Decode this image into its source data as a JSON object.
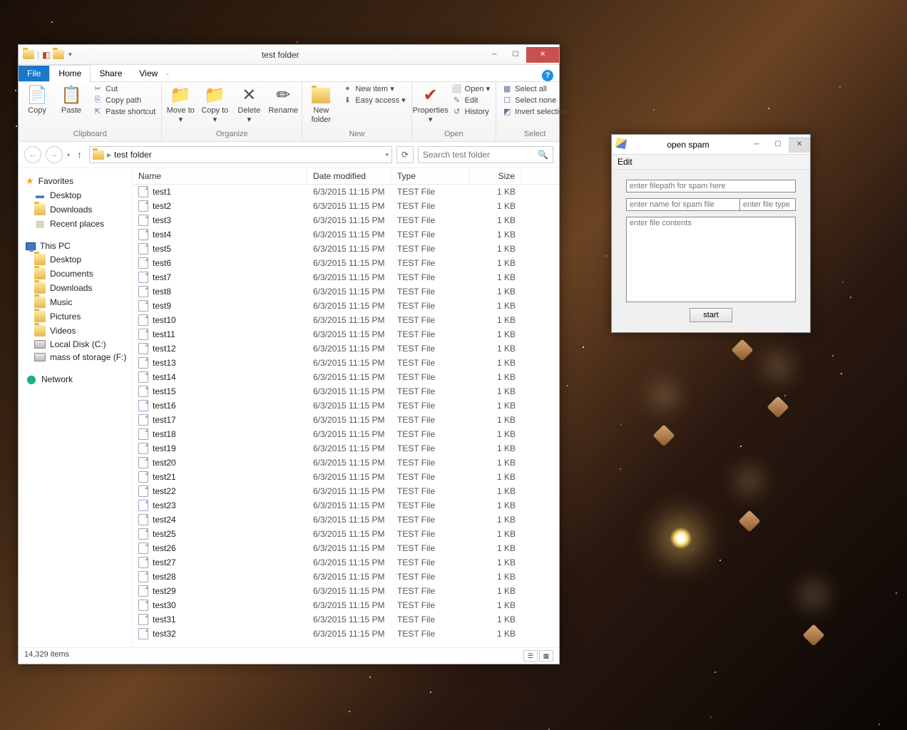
{
  "explorer": {
    "title": "test folder",
    "tabs": {
      "file": "File",
      "home": "Home",
      "share": "Share",
      "view": "View"
    },
    "ribbon": {
      "clipboard": {
        "copy": "Copy",
        "paste": "Paste",
        "cut": "Cut",
        "copy_path": "Copy path",
        "paste_shortcut": "Paste shortcut",
        "label": "Clipboard"
      },
      "organize": {
        "move_to": "Move to ▾",
        "copy_to": "Copy to ▾",
        "delete": "Delete ▾",
        "rename": "Rename",
        "label": "Organize"
      },
      "new": {
        "new_folder": "New folder",
        "new_item": "New item ▾",
        "easy_access": "Easy access ▾",
        "label": "New"
      },
      "open": {
        "properties": "Properties ▾",
        "open": "Open ▾",
        "edit": "Edit",
        "history": "History",
        "label": "Open"
      },
      "select": {
        "select_all": "Select all",
        "select_none": "Select none",
        "invert": "Invert selection",
        "label": "Select"
      }
    },
    "address": {
      "path": "test folder",
      "search_placeholder": "Search test folder"
    },
    "nav": {
      "favorites": "Favorites",
      "desktop": "Desktop",
      "downloads": "Downloads",
      "recent": "Recent places",
      "this_pc": "This PC",
      "documents": "Documents",
      "music": "Music",
      "pictures": "Pictures",
      "videos": "Videos",
      "local_disk": "Local Disk (C:)",
      "mass_storage": "mass of storage (F:)",
      "network": "Network"
    },
    "columns": {
      "name": "Name",
      "date": "Date modified",
      "type": "Type",
      "size": "Size"
    },
    "files": [
      {
        "name": "test1",
        "date": "6/3/2015 11:15 PM",
        "type": "TEST File",
        "size": "1 KB"
      },
      {
        "name": "test2",
        "date": "6/3/2015 11:15 PM",
        "type": "TEST File",
        "size": "1 KB"
      },
      {
        "name": "test3",
        "date": "6/3/2015 11:15 PM",
        "type": "TEST File",
        "size": "1 KB"
      },
      {
        "name": "test4",
        "date": "6/3/2015 11:15 PM",
        "type": "TEST File",
        "size": "1 KB"
      },
      {
        "name": "test5",
        "date": "6/3/2015 11:15 PM",
        "type": "TEST File",
        "size": "1 KB"
      },
      {
        "name": "test6",
        "date": "6/3/2015 11:15 PM",
        "type": "TEST File",
        "size": "1 KB"
      },
      {
        "name": "test7",
        "date": "6/3/2015 11:15 PM",
        "type": "TEST File",
        "size": "1 KB"
      },
      {
        "name": "test8",
        "date": "6/3/2015 11:15 PM",
        "type": "TEST File",
        "size": "1 KB"
      },
      {
        "name": "test9",
        "date": "6/3/2015 11:15 PM",
        "type": "TEST File",
        "size": "1 KB"
      },
      {
        "name": "test10",
        "date": "6/3/2015 11:15 PM",
        "type": "TEST File",
        "size": "1 KB"
      },
      {
        "name": "test11",
        "date": "6/3/2015 11:15 PM",
        "type": "TEST File",
        "size": "1 KB"
      },
      {
        "name": "test12",
        "date": "6/3/2015 11:15 PM",
        "type": "TEST File",
        "size": "1 KB"
      },
      {
        "name": "test13",
        "date": "6/3/2015 11:15 PM",
        "type": "TEST File",
        "size": "1 KB"
      },
      {
        "name": "test14",
        "date": "6/3/2015 11:15 PM",
        "type": "TEST File",
        "size": "1 KB"
      },
      {
        "name": "test15",
        "date": "6/3/2015 11:15 PM",
        "type": "TEST File",
        "size": "1 KB"
      },
      {
        "name": "test16",
        "date": "6/3/2015 11:15 PM",
        "type": "TEST File",
        "size": "1 KB"
      },
      {
        "name": "test17",
        "date": "6/3/2015 11:15 PM",
        "type": "TEST File",
        "size": "1 KB"
      },
      {
        "name": "test18",
        "date": "6/3/2015 11:15 PM",
        "type": "TEST File",
        "size": "1 KB"
      },
      {
        "name": "test19",
        "date": "6/3/2015 11:15 PM",
        "type": "TEST File",
        "size": "1 KB"
      },
      {
        "name": "test20",
        "date": "6/3/2015 11:15 PM",
        "type": "TEST File",
        "size": "1 KB"
      },
      {
        "name": "test21",
        "date": "6/3/2015 11:15 PM",
        "type": "TEST File",
        "size": "1 KB"
      },
      {
        "name": "test22",
        "date": "6/3/2015 11:15 PM",
        "type": "TEST File",
        "size": "1 KB"
      },
      {
        "name": "test23",
        "date": "6/3/2015 11:15 PM",
        "type": "TEST File",
        "size": "1 KB"
      },
      {
        "name": "test24",
        "date": "6/3/2015 11:15 PM",
        "type": "TEST File",
        "size": "1 KB"
      },
      {
        "name": "test25",
        "date": "6/3/2015 11:15 PM",
        "type": "TEST File",
        "size": "1 KB"
      },
      {
        "name": "test26",
        "date": "6/3/2015 11:15 PM",
        "type": "TEST File",
        "size": "1 KB"
      },
      {
        "name": "test27",
        "date": "6/3/2015 11:15 PM",
        "type": "TEST File",
        "size": "1 KB"
      },
      {
        "name": "test28",
        "date": "6/3/2015 11:15 PM",
        "type": "TEST File",
        "size": "1 KB"
      },
      {
        "name": "test29",
        "date": "6/3/2015 11:15 PM",
        "type": "TEST File",
        "size": "1 KB"
      },
      {
        "name": "test30",
        "date": "6/3/2015 11:15 PM",
        "type": "TEST File",
        "size": "1 KB"
      },
      {
        "name": "test31",
        "date": "6/3/2015 11:15 PM",
        "type": "TEST File",
        "size": "1 KB"
      },
      {
        "name": "test32",
        "date": "6/3/2015 11:15 PM",
        "type": "TEST File",
        "size": "1 KB"
      }
    ],
    "status": "14,329 items"
  },
  "app": {
    "title": "open spam",
    "menu_edit": "Edit",
    "filepath_placeholder": "enter filepath for spam here",
    "filename_placeholder": "enter name for spam file",
    "filetype_placeholder": "enter file type",
    "contents_placeholder": "enter file contents",
    "start": "start"
  }
}
